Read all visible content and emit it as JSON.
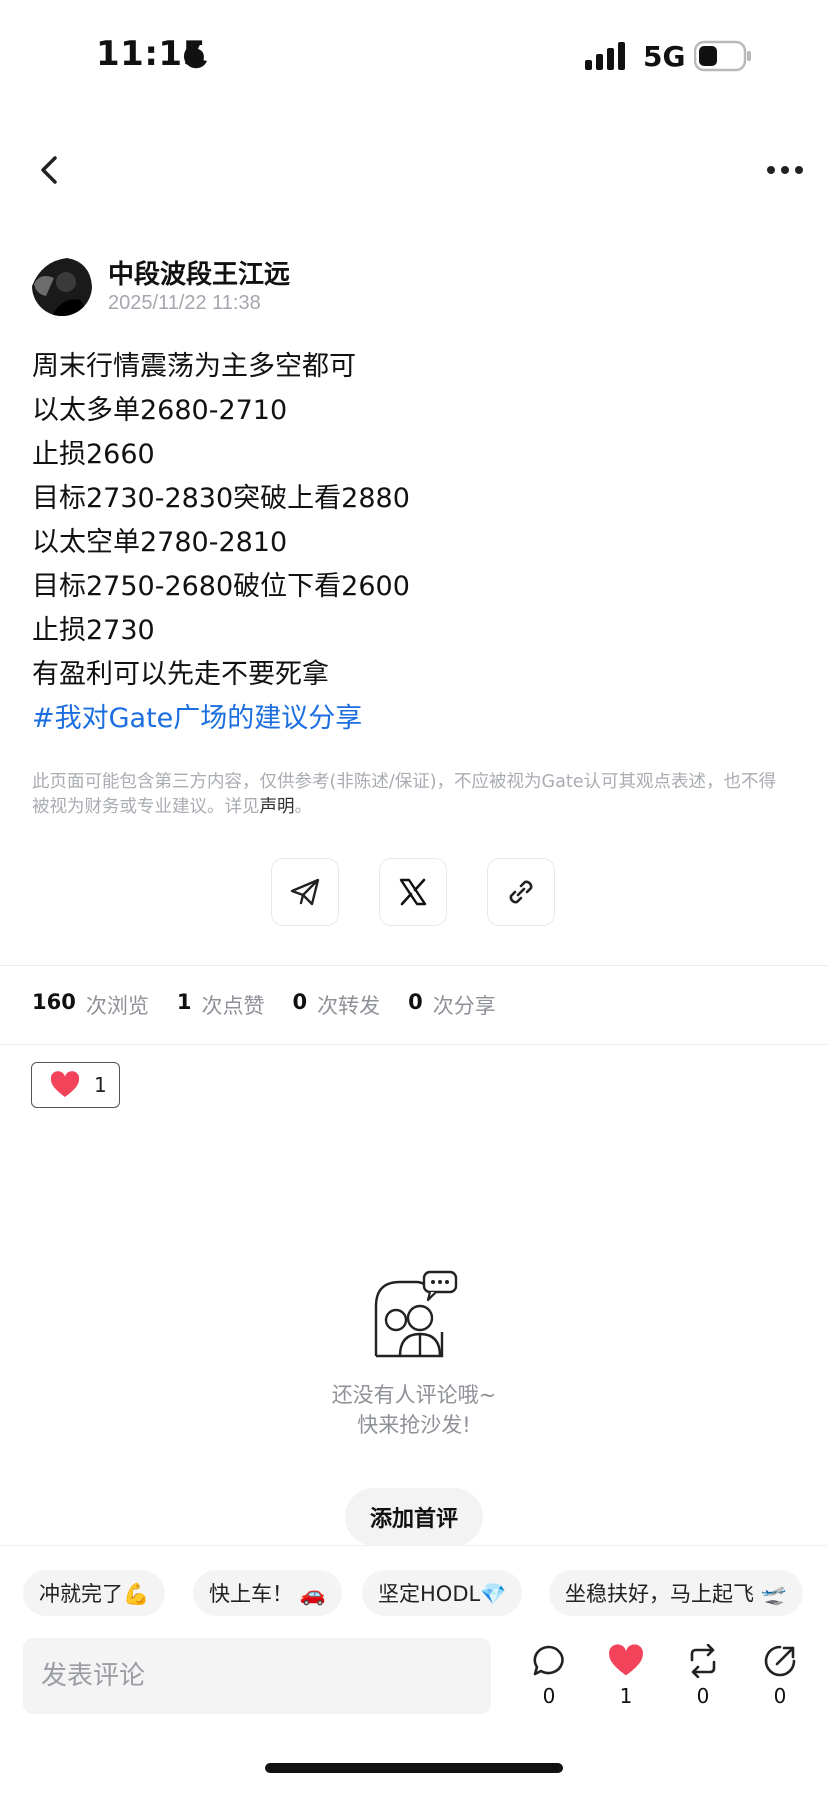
{
  "status_bar": {
    "time": "11:15",
    "network": "5G"
  },
  "author": {
    "name": "中段波段王江远",
    "timestamp": "2025/11/22 11:38"
  },
  "post": {
    "lines": [
      "周末行情震荡为主多空都可",
      "以太多单2680-2710",
      "止损2660",
      "目标2730-2830突破上看2880",
      "以太空单2780-2810",
      "目标2750-2680破位下看2600",
      "止损2730",
      "有盈利可以先走不要死拿"
    ],
    "hashtag": "#我对Gate广场的建议分享"
  },
  "disclaimer": {
    "text": "此页面可能包含第三方内容，仅供参考(非陈述/保证)，不应被视为Gate认可其观点表述，也不得被视为财务或专业建议。详见",
    "link": "声明",
    "suffix": "。"
  },
  "stats": {
    "views": "160",
    "views_label": "次浏览",
    "likes": "1",
    "likes_label": "次点赞",
    "reposts": "0",
    "reposts_label": "次转发",
    "shares": "0",
    "shares_label": "次分享"
  },
  "reaction": {
    "count": "1"
  },
  "empty_state": {
    "line1": "还没有人评论哦~",
    "line2": "快来抢沙发!"
  },
  "first_comment_button": "添加首评",
  "quick_replies": [
    "冲就完了💪",
    "快上车！ 🚗",
    "坚定HODL💎",
    "坐稳扶好，马上起飞 🛫"
  ],
  "bottom_bar": {
    "placeholder": "发表评论",
    "comment_count": "0",
    "like_count": "1",
    "repost_count": "0",
    "share_count": "0"
  },
  "colors": {
    "hashtag": "#1c6fe0",
    "heart": "#f2435a",
    "muted": "#a9acb2"
  }
}
